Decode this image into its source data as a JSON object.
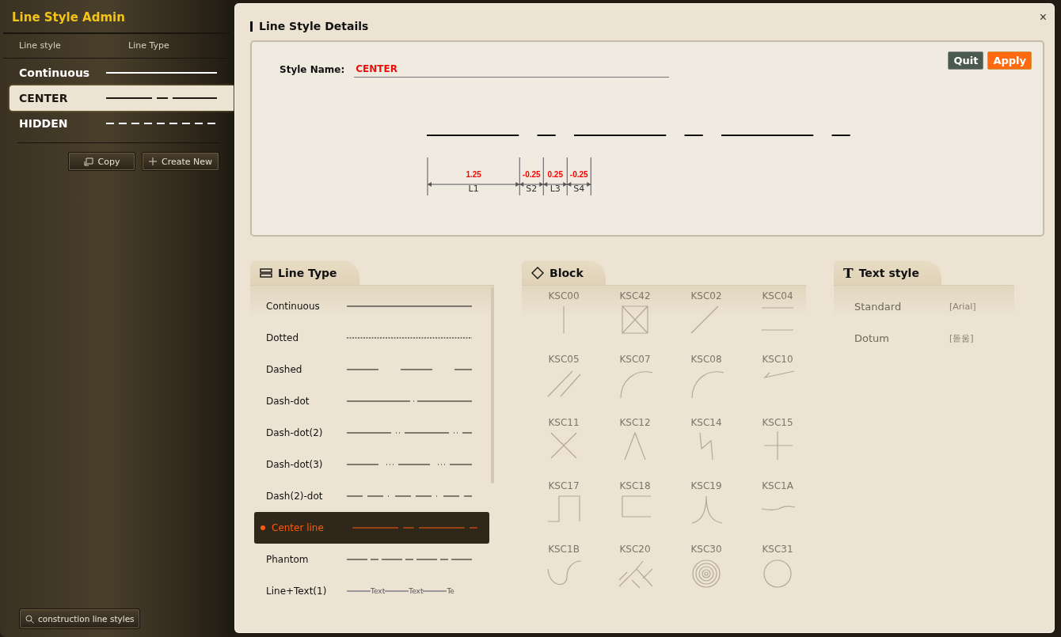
{
  "sidebar": {
    "title": "Line Style Admin",
    "columns": [
      "Line style",
      "Line Type"
    ],
    "styles": [
      {
        "name": "Continuous",
        "kind": "continuous",
        "selected": false
      },
      {
        "name": "CENTER",
        "kind": "center",
        "selected": true
      },
      {
        "name": "HIDDEN",
        "kind": "hidden",
        "selected": false
      }
    ],
    "buttons": [
      {
        "label": "Copy",
        "kind": "copy"
      },
      {
        "label": "Create New",
        "kind": "add"
      }
    ],
    "search": {
      "value": "construction line styles"
    }
  },
  "details": {
    "title": "Line Style Details",
    "close": "×",
    "style_name_label": "Style Name:",
    "style_name": "CENTER",
    "buttons": [
      {
        "label": "Quit",
        "kind": "quit"
      },
      {
        "label": "Apply",
        "kind": "apply"
      }
    ],
    "segments": [
      {
        "label": "L1",
        "value": "1.25"
      },
      {
        "label": "S2",
        "value": "-0.25"
      },
      {
        "label": "L3",
        "value": "0.25"
      },
      {
        "label": "S4",
        "value": "-0.25"
      }
    ]
  },
  "line_types": {
    "title": "Line Type",
    "items": [
      {
        "name": "Continuous",
        "kind": "continuous",
        "selected": false
      },
      {
        "name": "Dotted",
        "kind": "dotted",
        "selected": false
      },
      {
        "name": "Dashed",
        "kind": "dashed",
        "selected": false
      },
      {
        "name": "Dash-dot",
        "kind": "dash-dot",
        "selected": false
      },
      {
        "name": "Dash-dot(2)",
        "kind": "dash-dot-2",
        "selected": false
      },
      {
        "name": "Dash-dot(3)",
        "kind": "dash-dot-3",
        "selected": false
      },
      {
        "name": "Dash(2)-dot",
        "kind": "dash2-dot",
        "selected": false
      },
      {
        "name": "Center line",
        "kind": "center",
        "selected": true
      },
      {
        "name": "Phantom",
        "kind": "phantom",
        "selected": false
      },
      {
        "name": "Line+Text(1)",
        "kind": "line-text",
        "sample_texts": [
          "Text",
          "Text",
          "Te"
        ],
        "selected": false
      }
    ]
  },
  "blocks": {
    "title": "Block",
    "items": [
      {
        "name": "KSC00",
        "kind": "vertical"
      },
      {
        "name": "KSC42",
        "kind": "crossed-box"
      },
      {
        "name": "KSC02",
        "kind": "diagonal"
      },
      {
        "name": "KSC04",
        "kind": "double-line"
      },
      {
        "name": "KSC05",
        "kind": "double-diagonal"
      },
      {
        "name": "KSC07",
        "kind": "arc"
      },
      {
        "name": "KSC08",
        "kind": "arc-wide"
      },
      {
        "name": "KSC10",
        "kind": "tick"
      },
      {
        "name": "KSC11",
        "kind": "x-cross"
      },
      {
        "name": "KSC12",
        "kind": "peak"
      },
      {
        "name": "KSC14",
        "kind": "zigzag"
      },
      {
        "name": "KSC15",
        "kind": "plus"
      },
      {
        "name": "KSC17",
        "kind": "step"
      },
      {
        "name": "KSC18",
        "kind": "open-rect"
      },
      {
        "name": "KSC19",
        "kind": "cusp"
      },
      {
        "name": "KSC1A",
        "kind": "wave"
      },
      {
        "name": "KSC1B",
        "kind": "s-curve"
      },
      {
        "name": "KSC20",
        "kind": "hatch"
      },
      {
        "name": "KSC30",
        "kind": "concentric"
      },
      {
        "name": "KSC31",
        "kind": "circle"
      }
    ]
  },
  "text_styles": {
    "icon": "T",
    "title": "Text style",
    "items": [
      {
        "name": "Standard",
        "font": "[Arial]"
      },
      {
        "name": "Dotum",
        "font": "[돋움]"
      }
    ]
  }
}
